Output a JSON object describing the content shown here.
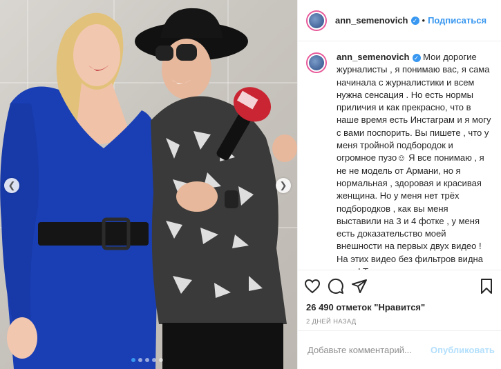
{
  "post": {
    "username": "ann_semenovich",
    "follow_label": "Подписаться",
    "caption": "Мои дорогие журналисты , я понимаю вас, я сама начинала с журналистики и всем нужна сенсация . Но есть нормы приличия и как прекрасно, что в наше время есть Инстаграм и я могу с вами поспорить. Вы пишете , что у меня тройной подбородок и огромное пузо☺ Я все понимаю , я не не модель от Армани, но я нормальная , здоровая и красивая женщина. Но у меня нет трёх подбородков , как вы меня выставили на 3 и 4 фотке , у меня есть доказательство моей внешности на первых двух видео ! На этих видео без фильтров видна вся я! Так зачем вы пишите , то , чего нет! Вас это делает счастливей? Или вам от этих статей повышают",
    "likes_text": "26 490 отметок \"Нравится\"",
    "time_ago": "2 ДНЕЙ НАЗАД",
    "comment_placeholder": "Добавьте комментарий...",
    "publish_label": "Опубликовать",
    "carousel": {
      "slides": 5,
      "active": 0
    }
  },
  "icons": [
    "heart-icon",
    "comment-icon",
    "share-icon",
    "bookmark-icon",
    "verified-icon",
    "chevron-left-icon",
    "chevron-right-icon"
  ],
  "colors": {
    "accent": "#3897f0",
    "publish_disabled": "#b2dffc",
    "muted": "#8e8e8e",
    "dress": "#1a3fb5"
  }
}
